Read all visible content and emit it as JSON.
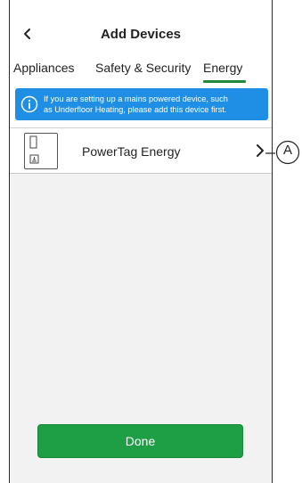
{
  "header": {
    "back_icon": "chevron-left-icon",
    "title": "Add Devices"
  },
  "tabs": [
    {
      "label": "Appliances",
      "selected": false
    },
    {
      "label": "Safety & Security",
      "selected": false
    },
    {
      "label": "Energy",
      "selected": true
    }
  ],
  "accent_color": "#1e8a3a",
  "banner": {
    "icon": "info-icon",
    "line1": "If you are setting up a mains powered device, such",
    "line2": "as Underfloor Heating, please add this device first.",
    "color": "#1f8fe6"
  },
  "devices": [
    {
      "label": "PowerTag Energy",
      "icon": "powertag-device-icon",
      "chevron": "chevron-right-icon"
    }
  ],
  "done_button": {
    "label": "Done",
    "color": "#1e9e45"
  },
  "callout": {
    "label": "A"
  }
}
